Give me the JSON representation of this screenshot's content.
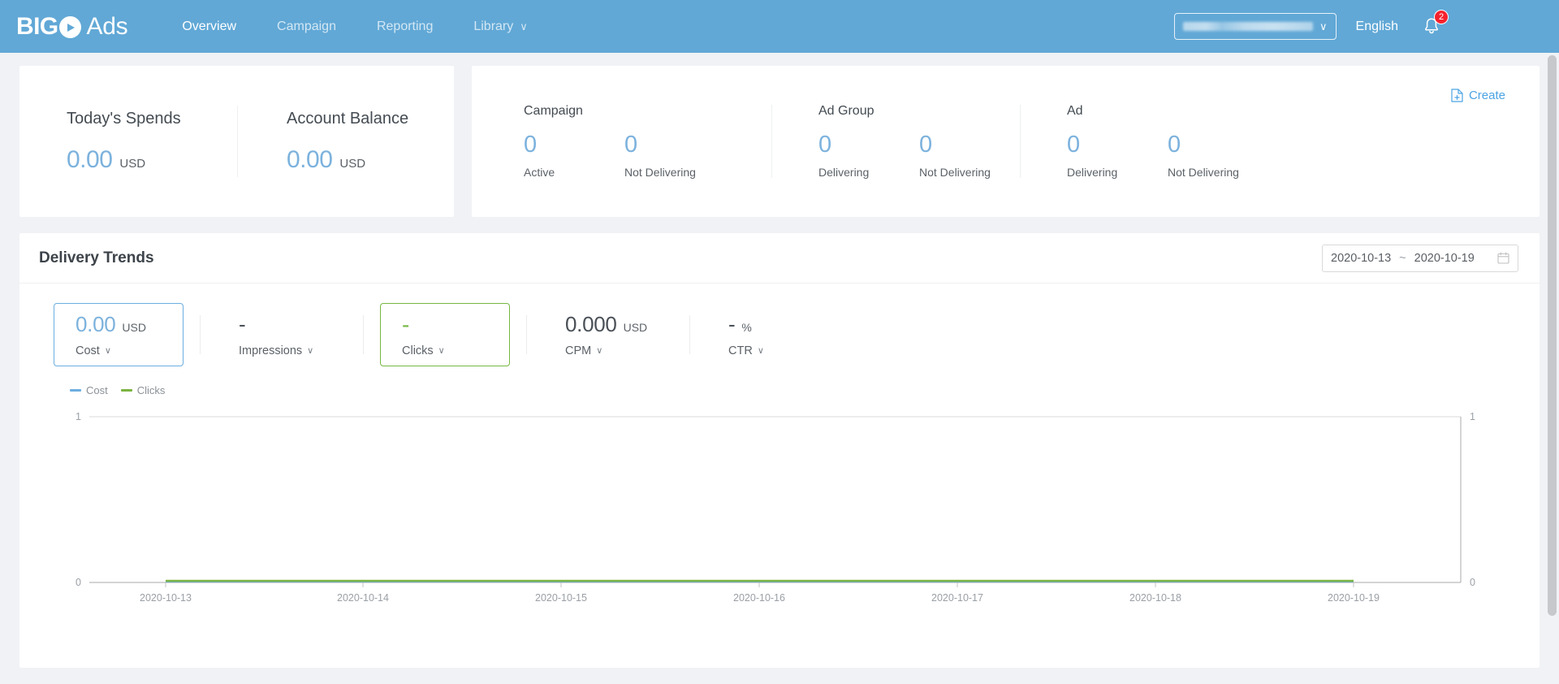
{
  "header": {
    "logo": {
      "brand": "BIGO",
      "suffix": "Ads",
      "play_icon": "play-circle-icon"
    },
    "nav": [
      {
        "label": "Overview",
        "active": true
      },
      {
        "label": "Campaign",
        "active": false
      },
      {
        "label": "Reporting",
        "active": false
      },
      {
        "label": "Library",
        "active": false,
        "chevron": "∨"
      }
    ],
    "account_select": {
      "value": "",
      "chevron": "∨"
    },
    "language": "English",
    "notifications": {
      "icon": "bell-icon",
      "count": "2"
    },
    "user": {
      "name": ""
    }
  },
  "balance_card": {
    "items": [
      {
        "title": "Today's Spends",
        "value": "0.00",
        "currency": "USD"
      },
      {
        "title": "Account Balance",
        "value": "0.00",
        "currency": "USD"
      }
    ]
  },
  "counts_card": {
    "create_label": "Create",
    "create_icon": "file-add-icon",
    "groups": [
      {
        "title": "Campaign",
        "metrics": [
          {
            "value": "0",
            "label": "Active"
          },
          {
            "value": "0",
            "label": "Not Delivering"
          }
        ]
      },
      {
        "title": "Ad Group",
        "metrics": [
          {
            "value": "0",
            "label": "Delivering"
          },
          {
            "value": "0",
            "label": "Not Delivering"
          }
        ]
      },
      {
        "title": "Ad",
        "metrics": [
          {
            "value": "0",
            "label": "Delivering"
          },
          {
            "value": "0",
            "label": "Not Delivering"
          }
        ]
      }
    ]
  },
  "trends": {
    "title": "Delivery Trends",
    "date_range": {
      "start": "2020-10-13",
      "separator": "~",
      "end": "2020-10-19",
      "icon": "calendar-icon"
    },
    "metrics": [
      {
        "value": "0.00",
        "unit": "USD",
        "label": "Cost",
        "selected": "blue",
        "chevron": "∨"
      },
      {
        "value": "-",
        "unit": "",
        "label": "Impressions",
        "selected": "none",
        "chevron": "∨"
      },
      {
        "value": "-",
        "unit": "",
        "label": "Clicks",
        "selected": "green",
        "chevron": "∨"
      },
      {
        "value": "0.000",
        "unit": "USD",
        "label": "CPM",
        "selected": "none",
        "chevron": "∨"
      },
      {
        "value": "-",
        "unit": "%",
        "label": "CTR",
        "selected": "none",
        "chevron": "∨"
      }
    ],
    "legend": [
      {
        "label": "Cost",
        "color": "#6caee0"
      },
      {
        "label": "Clicks",
        "color": "#7cb342"
      }
    ]
  },
  "chart_data": {
    "type": "line",
    "title": "Delivery Trends",
    "x": [
      "2020-10-13",
      "2020-10-14",
      "2020-10-15",
      "2020-10-16",
      "2020-10-17",
      "2020-10-18",
      "2020-10-19"
    ],
    "series": [
      {
        "name": "Cost",
        "color": "#6caee0",
        "axis": "left",
        "values": [
          0,
          0,
          0,
          0,
          0,
          0,
          0
        ]
      },
      {
        "name": "Clicks",
        "color": "#7cb342",
        "axis": "right",
        "values": [
          0,
          0,
          0,
          0,
          0,
          0,
          0
        ]
      }
    ],
    "left_axis": {
      "ticks": [
        "0",
        "1"
      ],
      "min": 0,
      "max": 1
    },
    "right_axis": {
      "ticks": [
        "0",
        "1"
      ],
      "min": 0,
      "max": 1
    },
    "xlabel": "",
    "ylabel": "",
    "grid": true,
    "legend_position": "top-left"
  },
  "colors": {
    "header_bg": "#61a8d6",
    "page_bg": "#f0f2f5",
    "accent_blue": "#7cb2dd",
    "accent_green": "#76b843",
    "badge_red": "#f5222d"
  }
}
